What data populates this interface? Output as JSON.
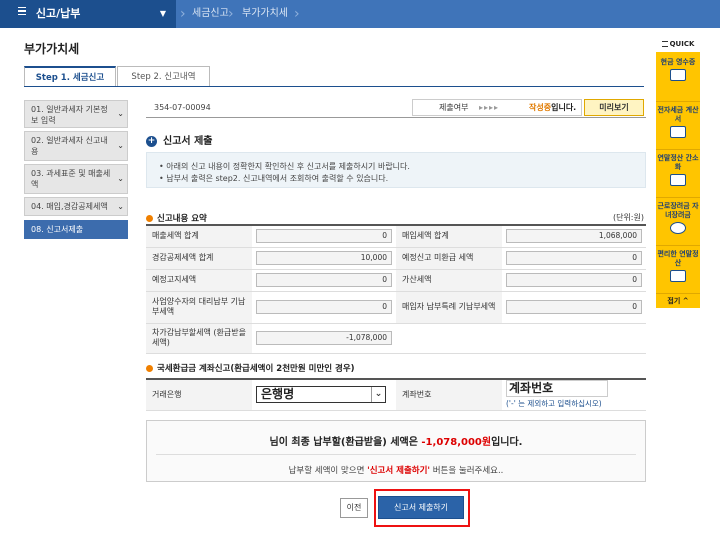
{
  "topbar": {
    "menu_label": "신고/납부",
    "menu_caret": "▼",
    "breadcrumb": [
      "세금신고",
      "부가가치세"
    ]
  },
  "page_title": "부가가치세",
  "tabs": [
    {
      "label": "Step 1. 세금신고",
      "active": true
    },
    {
      "label": "Step 2. 신고내역",
      "active": false
    }
  ],
  "steps": [
    {
      "label": "01. 일반과세자 기본정보 입력",
      "active": false
    },
    {
      "label": "02. 일반과세자 신고내용",
      "active": false
    },
    {
      "label": "03. 과세표준 및 매출세액",
      "active": false
    },
    {
      "label": "04. 매입,경감공제세액",
      "active": false
    },
    {
      "label": "08. 신고서제출",
      "active": true
    }
  ],
  "header": {
    "business_no": "354-07-00094",
    "status_label": "제출여부",
    "status_arrows": "▸▸▸▸",
    "status_value_prefix": "작성중",
    "status_value_suffix": "입니다.",
    "preview_button": "미리보기"
  },
  "section": {
    "title": "신고서 제출",
    "notice_lines": [
      "• 아래의 신고 내용이 정확한지 확인하신 후 신고서를 제출하시기 바랍니다.",
      "• 납부서 출력은 step2. 신고내역에서 조회하여 출력할 수 있습니다."
    ]
  },
  "summary": {
    "heading": "신고내용 요약",
    "unit": "(단위:원)",
    "rows": [
      {
        "left_label": "매출세액 합계",
        "left_value": "0",
        "right_label": "매입세액 합계",
        "right_value": "1,068,000"
      },
      {
        "left_label": "경감공제세액 합계",
        "left_value": "10,000",
        "right_label": "예정신고 미환급 세액",
        "right_value": "0"
      },
      {
        "left_label": "예정고지세액",
        "left_value": "0",
        "right_label": "가산세액",
        "right_value": "0"
      },
      {
        "left_label": "사업양수자의 대리납부 기납부세액",
        "left_value": "0",
        "right_label": "매입자 납부특례 기납부세액",
        "right_value": "0"
      },
      {
        "left_label": "차가감납부할세액 (환급받을세액)",
        "left_value": "-1,078,000",
        "right_label": "",
        "right_value": ""
      }
    ]
  },
  "refund_account": {
    "heading": "국세환급금 계좌신고(환급세액이 2천만원 미만인 경우)",
    "bank_label": "거래은행",
    "bank_select": "은행명",
    "account_label": "계좌번호",
    "account_value": "계좌번호",
    "hint": "('-' 는 제외하고 입력하십시오)"
  },
  "result": {
    "line1_prefix": "님이 최종 납부할(환급받을) 세액은 ",
    "line1_amount": "-1,078,000원",
    "line1_suffix": "입니다.",
    "line2_prefix": "납부할 세액이 맞으면 ",
    "line2_quoted": "'신고서 제출하기'",
    "line2_suffix": " 버튼을 눌러주세요.."
  },
  "buttons": {
    "prev": "이전",
    "submit": "신고서 제출하기"
  },
  "quick": {
    "title": "QUICK",
    "items": [
      "현금 영수증",
      "전자세금 계산서",
      "연말정산 간소화",
      "근로장려금 자녀장려금",
      "편리한 연말정산"
    ],
    "close": "접기 ^"
  },
  "colors": {
    "brand": "#1c4f8e",
    "quick_bg": "#ffc500",
    "highlight": "#ee1111"
  }
}
